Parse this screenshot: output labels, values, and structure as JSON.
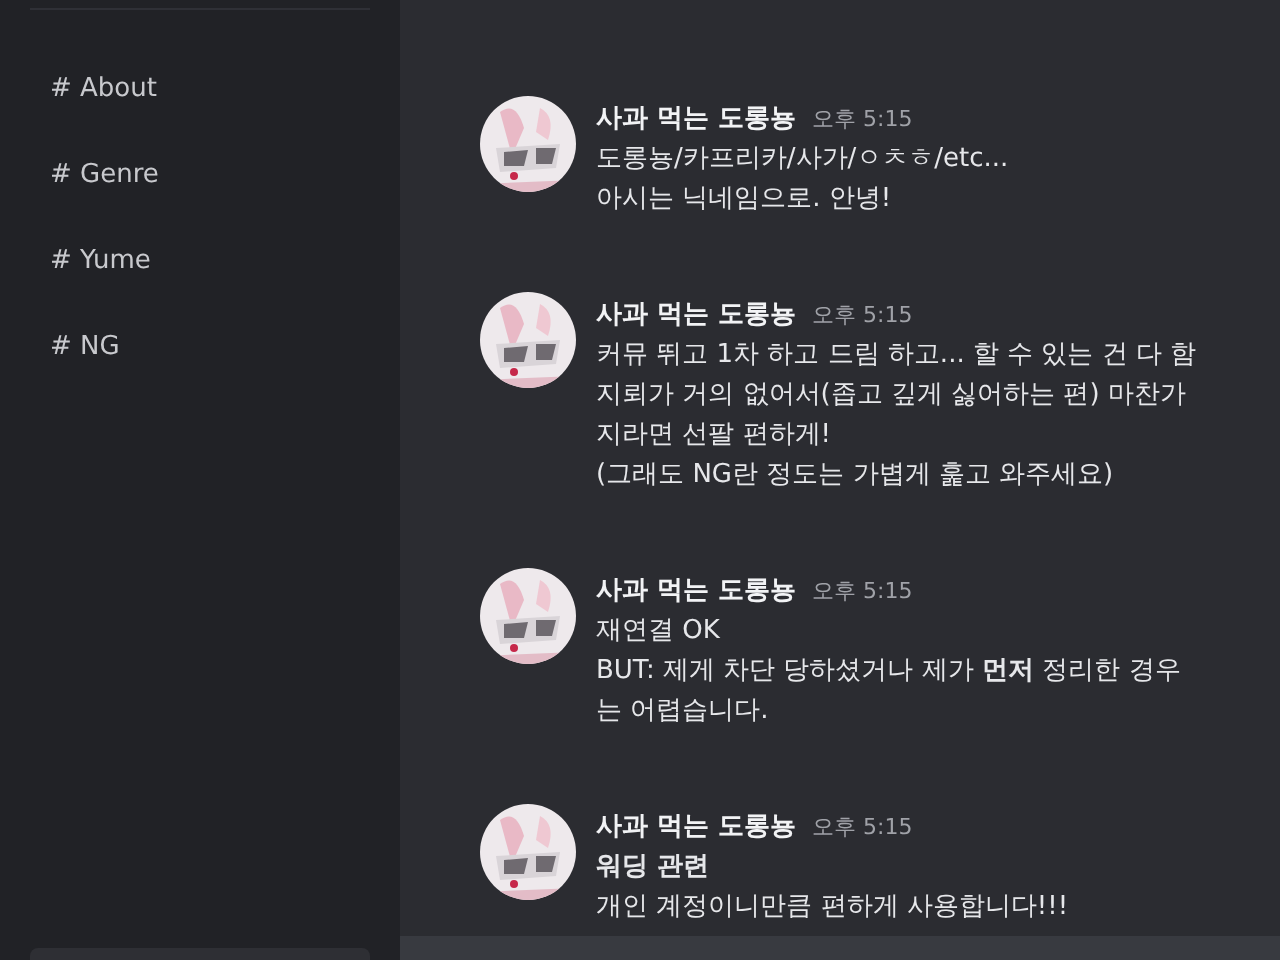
{
  "sidebar": {
    "channels": [
      {
        "label": "# About"
      },
      {
        "label": "# Genre"
      },
      {
        "label": "# Yume"
      },
      {
        "label": "# NG"
      }
    ]
  },
  "messages": [
    {
      "author": "사과 먹는 도롱뇽",
      "time": "오후 5:15",
      "lines": [
        {
          "kind": "text",
          "text": "도롱뇽/카프리카/사가/ㅇㅊㅎ/etc..."
        },
        {
          "kind": "text",
          "text": "아시는 닉네임으로. 안녕!"
        }
      ]
    },
    {
      "author": "사과 먹는 도롱뇽",
      "time": "오후 5:15",
      "lines": [
        {
          "kind": "text",
          "text": "커뮤 뛰고 1차 하고 드림 하고... 할 수 있는 건 다 함"
        },
        {
          "kind": "text",
          "text": "지뢰가 거의 없어서(좁고 깊게 싫어하는 편) 마찬가"
        },
        {
          "kind": "text",
          "text": "지라면 선팔 편하게!"
        },
        {
          "kind": "text",
          "text": "(그래도 NG란 정도는 가볍게 훑고 와주세요)"
        }
      ]
    },
    {
      "author": "사과 먹는 도롱뇽",
      "time": "오후 5:15",
      "lines": [
        {
          "kind": "text",
          "text": "재연결 OK"
        },
        {
          "kind": "text",
          "text": "BUT: 제게 차단 당하셨거나 제가 **먼저** 정리한 경우"
        },
        {
          "kind": "text",
          "text": "는 어렵습니다."
        }
      ]
    },
    {
      "author": "사과 먹는 도롱뇽",
      "time": "오후 5:15",
      "lines": [
        {
          "kind": "heading",
          "text": "워딩 관련"
        },
        {
          "kind": "text",
          "text": "개인 계정이니만큼 편하게 사용합니다!!!"
        }
      ]
    }
  ]
}
